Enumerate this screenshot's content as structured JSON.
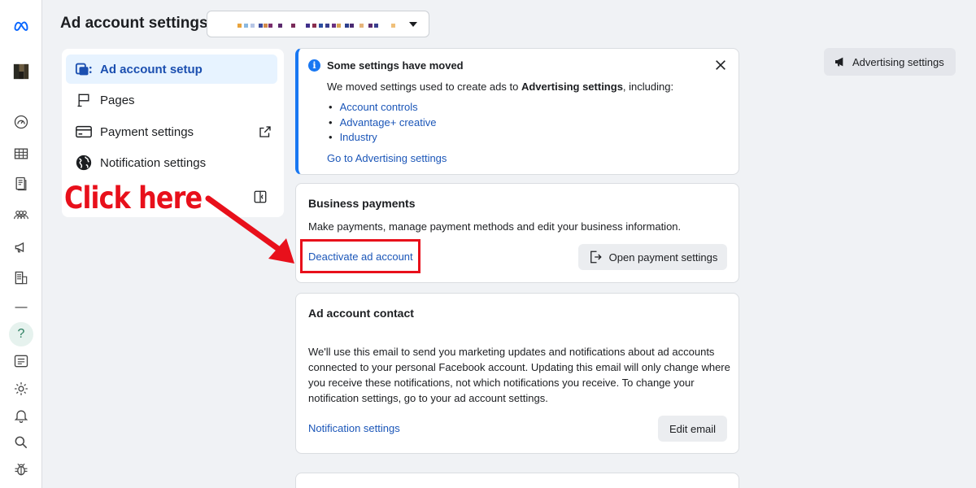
{
  "header": {
    "title": "Ad account settings"
  },
  "menu": {
    "items": [
      {
        "label": "Ad account setup",
        "icon": "ad-account-setup-icon"
      },
      {
        "label": "Pages",
        "icon": "flag-icon"
      },
      {
        "label": "Payment settings",
        "icon": "credit-card-icon"
      },
      {
        "label": "Notification settings",
        "icon": "globe-icon"
      }
    ]
  },
  "callout": {
    "text": "Click here",
    "color": "#e8101b"
  },
  "notice": {
    "title": "Some settings have moved",
    "body_prefix": "We moved settings used to create ads to ",
    "body_bold": "Advertising settings",
    "body_suffix": ", including:",
    "items": [
      "Account controls",
      "Advantage+ creative",
      "Industry"
    ],
    "link": "Go to Advertising settings"
  },
  "business_payments": {
    "title": "Business payments",
    "text": "Make payments, manage payment methods and edit your business information.",
    "link": "Deactivate ad account",
    "button": "Open payment settings"
  },
  "ad_account_contact": {
    "title": "Ad account contact",
    "text": "We'll use this email to send you marketing updates and notifications about ad accounts connected to your personal Facebook account. Updating this email will only change where you receive these notifications, not which notifications you receive. To change your notification settings, go to your ad account settings.",
    "link": "Notification settings",
    "button": "Edit email"
  },
  "advertising_settings": {
    "label": "Advertising settings"
  },
  "colors": {
    "accent": "#1877f2",
    "link": "#1b56b8",
    "active_bg": "#e7f3ff"
  }
}
